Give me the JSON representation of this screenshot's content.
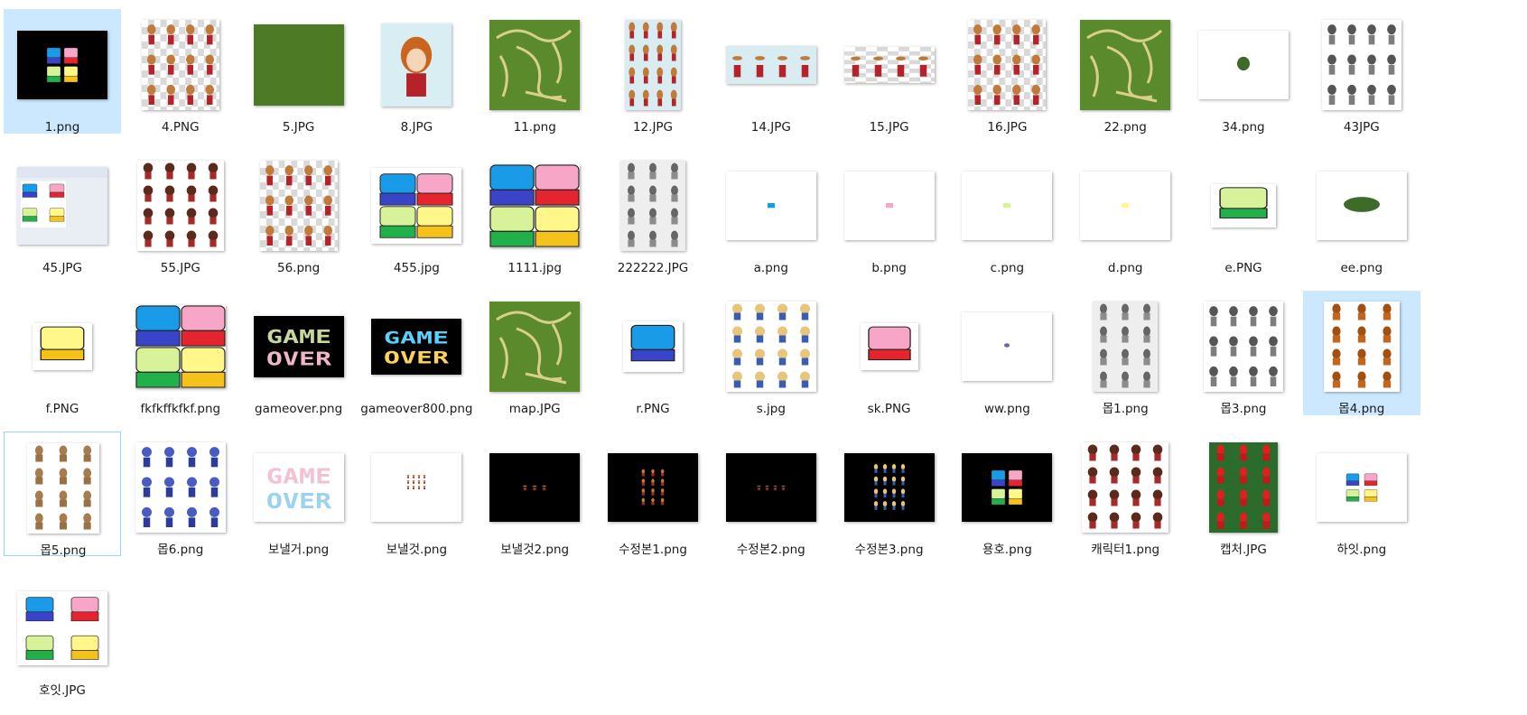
{
  "files": [
    {
      "name": "1.png",
      "kind": "blackquad",
      "selected": true
    },
    {
      "name": "4.PNG",
      "kind": "sprites-checker"
    },
    {
      "name": "5.JPG",
      "kind": "grass"
    },
    {
      "name": "8.JPG",
      "kind": "boy"
    },
    {
      "name": "11.png",
      "kind": "map"
    },
    {
      "name": "12.JPG",
      "kind": "sprites-lightblue"
    },
    {
      "name": "14.JPG",
      "kind": "strip-lightblue"
    },
    {
      "name": "15.JPG",
      "kind": "strip-checker"
    },
    {
      "name": "16.JPG",
      "kind": "sprites-checker"
    },
    {
      "name": "22.png",
      "kind": "map"
    },
    {
      "name": "34.png",
      "kind": "blob-small"
    },
    {
      "name": "43JPG",
      "kind": "dragons"
    },
    {
      "name": "45.JPG",
      "kind": "paint"
    },
    {
      "name": "55.JPG",
      "kind": "walkers"
    },
    {
      "name": "56.png",
      "kind": "sprites-checker"
    },
    {
      "name": "455.jpg",
      "kind": "quad-small"
    },
    {
      "name": "1111.jpg",
      "kind": "quad-big"
    },
    {
      "name": "222222.JPG",
      "kind": "robots"
    },
    {
      "name": "a.png",
      "kind": "dot-blue"
    },
    {
      "name": "b.png",
      "kind": "dot-pink"
    },
    {
      "name": "c.png",
      "kind": "dot-green"
    },
    {
      "name": "d.png",
      "kind": "dot-yellow"
    },
    {
      "name": "e.PNG",
      "kind": "block-green"
    },
    {
      "name": "ee.png",
      "kind": "blob-big"
    },
    {
      "name": "f.PNG",
      "kind": "block-yellow"
    },
    {
      "name": "fkfkffkfkf.png",
      "kind": "quad-big"
    },
    {
      "name": "gameover.png",
      "kind": "gameover-pastel"
    },
    {
      "name": "gameover800.png",
      "kind": "gameover-bright"
    },
    {
      "name": "map.JPG",
      "kind": "map"
    },
    {
      "name": "r.PNG",
      "kind": "block-blue"
    },
    {
      "name": "s.jpg",
      "kind": "blonde"
    },
    {
      "name": "sk.PNG",
      "kind": "block-pink"
    },
    {
      "name": "ww.png",
      "kind": "tiny-dot"
    },
    {
      "name": "몹1.png",
      "kind": "robots"
    },
    {
      "name": "몹3.png",
      "kind": "dragons"
    },
    {
      "name": "몹4.png",
      "kind": "brown-beasts",
      "selected": true
    },
    {
      "name": "몹5.png",
      "kind": "rocks",
      "focused": true
    },
    {
      "name": "몹6.png",
      "kind": "blue-wizards"
    },
    {
      "name": "보낼거.png",
      "kind": "gameover-white"
    },
    {
      "name": "보낼것.png",
      "kind": "tiny-sprites"
    },
    {
      "name": "보낼것2.png",
      "kind": "black-3sprites"
    },
    {
      "name": "수정본1.png",
      "kind": "black-sprites"
    },
    {
      "name": "수정본2.png",
      "kind": "black-4sprites"
    },
    {
      "name": "수정본3.png",
      "kind": "black-blonde"
    },
    {
      "name": "용호.png",
      "kind": "blackquad-large"
    },
    {
      "name": "캐릭터1.png",
      "kind": "walkers"
    },
    {
      "name": "캡처.JPG",
      "kind": "red-hoods"
    },
    {
      "name": "하잇.png",
      "kind": "white-quad-small"
    },
    {
      "name": "호잇.JPG",
      "kind": "white-quad-big"
    }
  ],
  "palette": {
    "blue": "#1a9be8",
    "blue_side": "#3a44c8",
    "pink": "#f7a6c8",
    "pink_side": "#e4252f",
    "green": "#d8f29a",
    "green_side": "#22b04a",
    "yellow": "#fff78a",
    "yellow_side": "#f4c21a",
    "grass": "#5a8a2c",
    "path": "#d9cf8a"
  }
}
